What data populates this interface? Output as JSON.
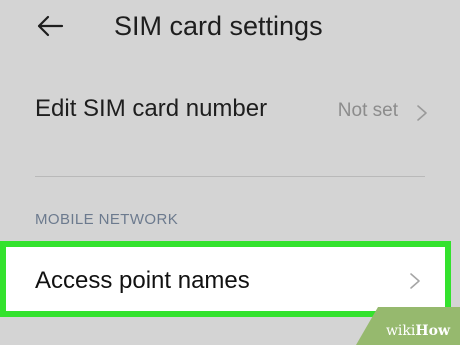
{
  "header": {
    "title": "SIM card settings",
    "back_icon": "arrow-left-icon"
  },
  "sim_number_row": {
    "label": "Edit SIM card number",
    "value": "Not set",
    "chevron_icon": "chevron-right-icon"
  },
  "mobile_network_section": {
    "heading": "MOBILE NETWORK"
  },
  "apn_row": {
    "label": "Access point names",
    "chevron_icon": "chevron-right-icon",
    "highlight_color": "#33e22d"
  },
  "watermark": {
    "prefix": "wiki",
    "suffix": "How",
    "background_color": "#96b96e"
  },
  "colors": {
    "background": "#d4d4d4",
    "text_primary": "#1e1e1e",
    "text_secondary": "#8c8c8c",
    "section_heading": "#6c7a8e"
  }
}
